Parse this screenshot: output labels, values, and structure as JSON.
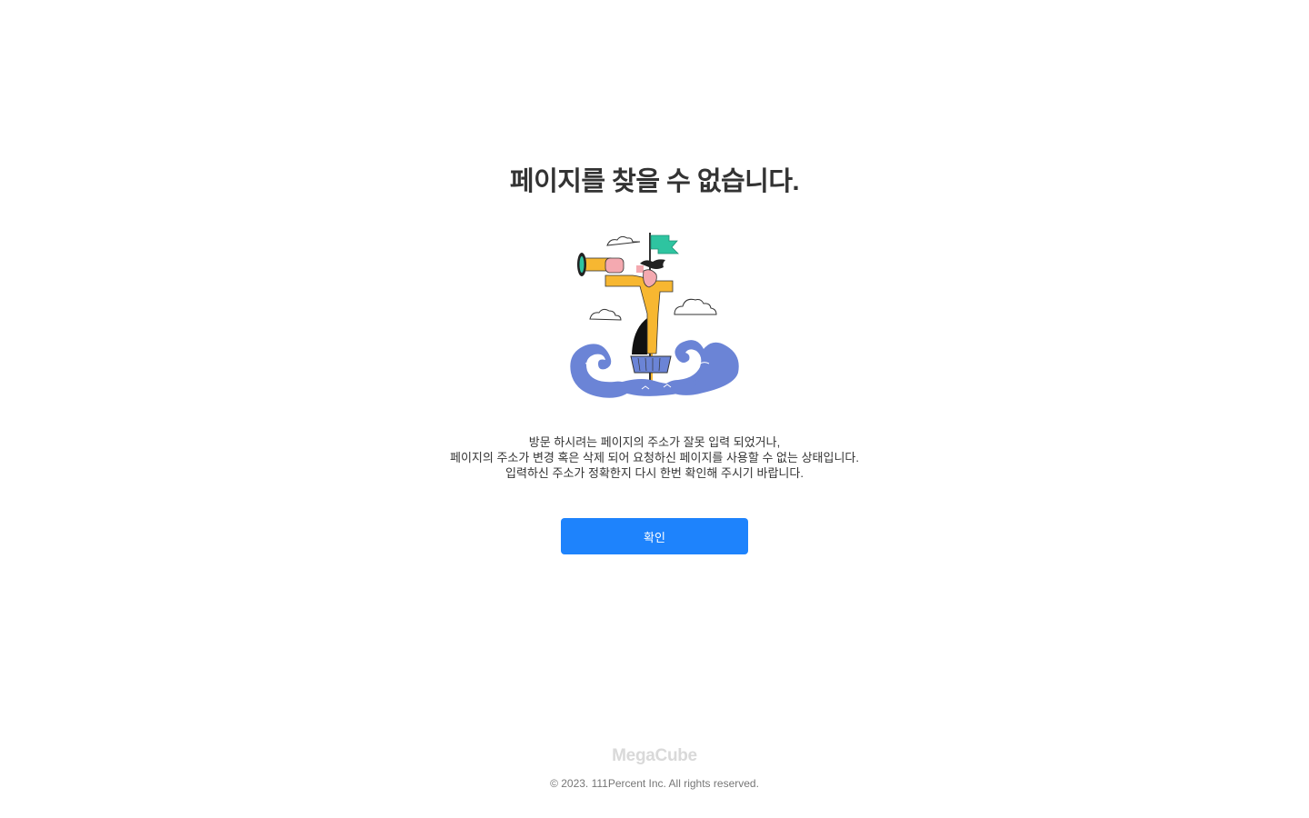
{
  "error": {
    "title": "페이지를 찾을 수 없습니다.",
    "message_lines": [
      "방문 하시려는 페이지의 주소가 잘못 입력 되었거나,",
      "페이지의 주소가 변경 혹은 삭제 되어 요청하신 페이지를 사용할 수 없는 상태입니다.",
      "입력하신 주소가 정확한지 다시 한번 확인해 주시기 바랍니다."
    ],
    "confirm_label": "확인"
  },
  "footer": {
    "logo": "MegaCube",
    "copyright": "© 2023. 111Percent Inc. All rights reserved."
  },
  "colors": {
    "primary": "#1e83fc",
    "title_text": "#333333",
    "logo_gray": "#d9d9d9",
    "copyright_gray": "#777777",
    "wave_blue": "#6b84d6",
    "coat_yellow": "#f7b731",
    "flag_green": "#2ec4a0"
  },
  "illustration": {
    "icon": "lookout-telescope-boat-illustration"
  }
}
